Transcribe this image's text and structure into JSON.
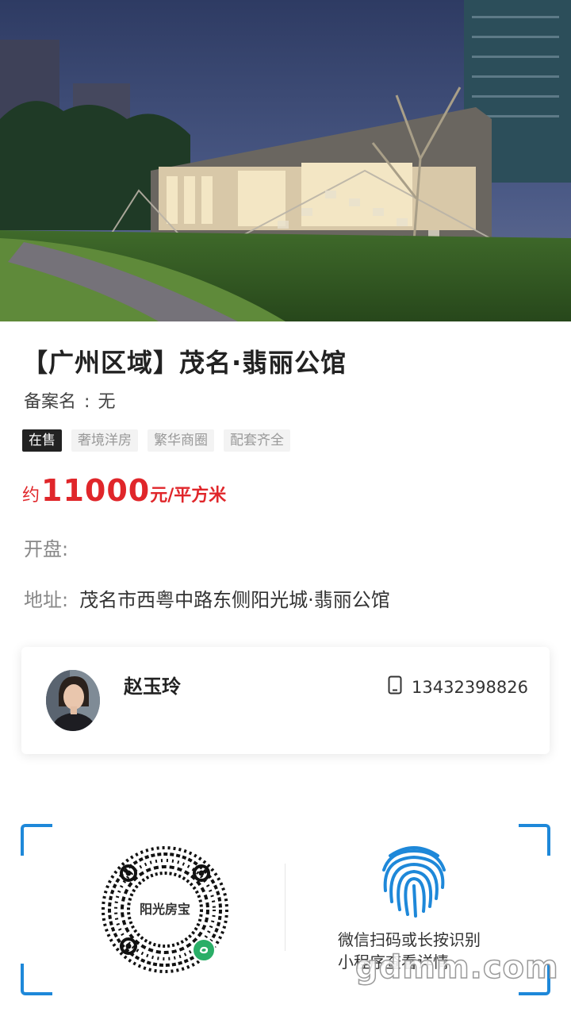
{
  "property": {
    "title": "【广州区域】茂名·翡丽公馆",
    "record_label": "备案名",
    "record_sep": ":",
    "record_value": "无",
    "tags": [
      "在售",
      "奢境洋房",
      "繁华商圈",
      "配套齐全"
    ],
    "price_prefix": "约",
    "price_value": "11000",
    "price_unit": "元/平方米",
    "open_label": "开盘:",
    "open_value": "",
    "address_label": "地址:",
    "address_value": "茂名市西粤中路东侧阳光城·翡丽公馆"
  },
  "agent": {
    "name": "赵玉玲",
    "phone": "13432398826"
  },
  "qr": {
    "label": "阳光房宝",
    "hint_line1": "微信扫码或长按识别",
    "hint_line2": "小程序查看详情"
  },
  "watermark": "gdmm.com",
  "colors": {
    "price": "#e0262a",
    "accent": "#1e88d9",
    "tag_active_bg": "#222222",
    "wechat_green": "#2aae67"
  },
  "icons": {
    "phone": "phone-icon",
    "fingerprint": "fingerprint-icon",
    "mini_program": "wechat-mini-program-icon"
  }
}
